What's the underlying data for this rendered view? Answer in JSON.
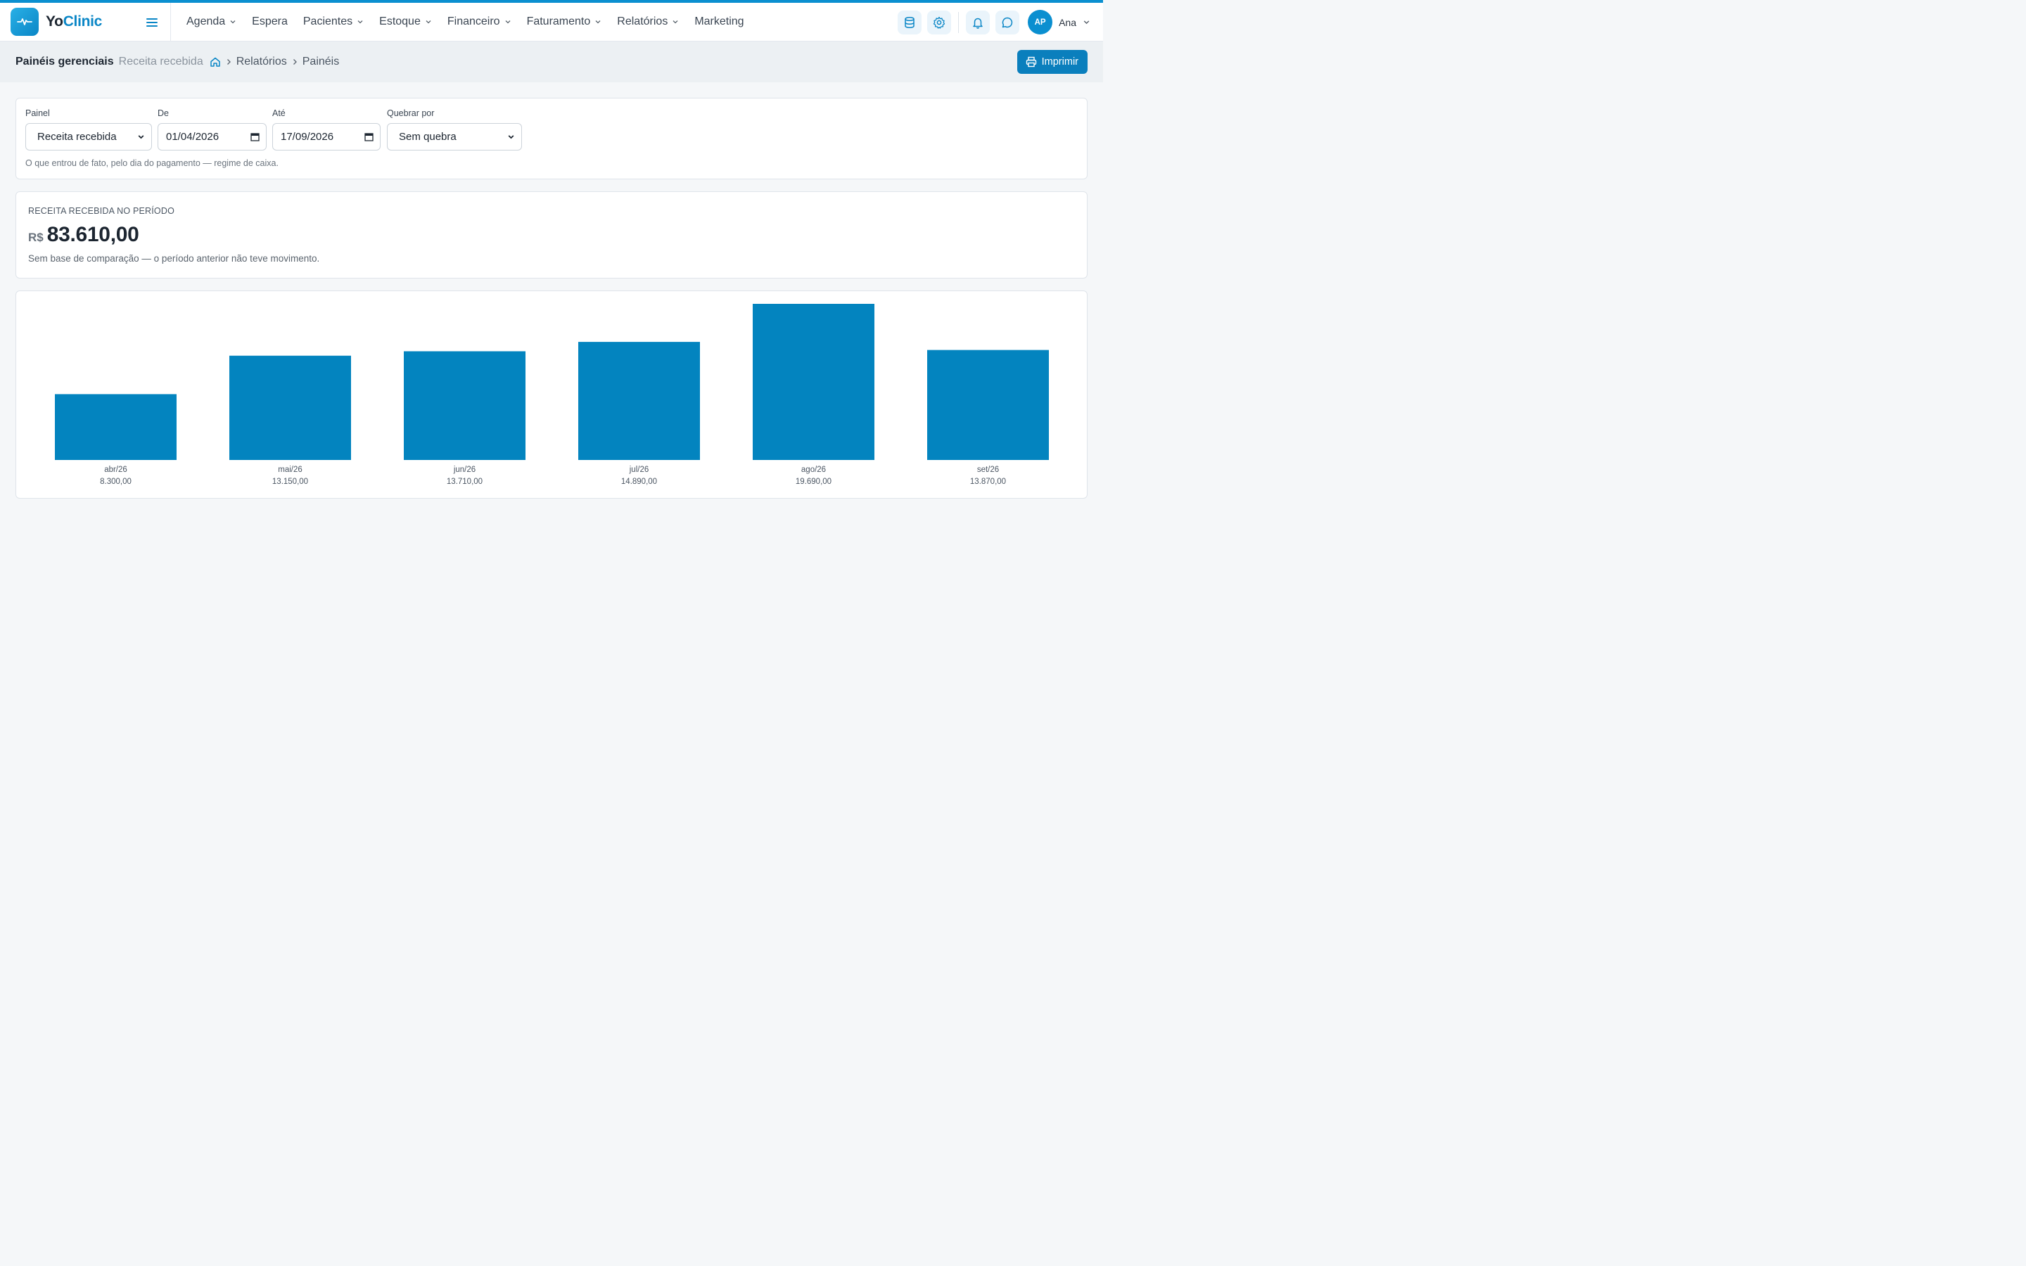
{
  "brand": {
    "name_part1": "Yo",
    "name_part2": "Clinic"
  },
  "menu": [
    {
      "label": "Agenda",
      "dropdown": true
    },
    {
      "label": "Espera",
      "dropdown": false
    },
    {
      "label": "Pacientes",
      "dropdown": true
    },
    {
      "label": "Estoque",
      "dropdown": true
    },
    {
      "label": "Financeiro",
      "dropdown": true
    },
    {
      "label": "Faturamento",
      "dropdown": true
    },
    {
      "label": "Relatórios",
      "dropdown": true
    },
    {
      "label": "Marketing",
      "dropdown": false
    }
  ],
  "user": {
    "initials": "AP",
    "name": "Ana"
  },
  "header": {
    "title": "Painéis gerenciais",
    "subtitle": "Receita recebida",
    "breadcrumb": [
      "Relatórios",
      "Painéis"
    ],
    "print_label": "Imprimir"
  },
  "filters": {
    "panel_label": "Painel",
    "panel_value": "Receita recebida",
    "from_label": "De",
    "from_value": "01/04/2026",
    "to_label": "Até",
    "to_value": "17/09/2026",
    "break_label": "Quebrar por",
    "break_value": "Sem quebra",
    "hint": "O que entrou de fato, pelo dia do pagamento — regime de caixa."
  },
  "kpi": {
    "label": "RECEITA RECEBIDA NO PERÍODO",
    "currency": "R$",
    "amount": "83.610,00",
    "note": "Sem base de comparação — o período anterior não teve movimento."
  },
  "colors": {
    "accent": "#0a8fd0",
    "bar": "#0384bf",
    "button": "#0a7fbd"
  },
  "chart_data": {
    "type": "bar",
    "categories": [
      "abr/26",
      "mai/26",
      "jun/26",
      "jul/26",
      "ago/26",
      "set/26"
    ],
    "values": [
      8300,
      13150,
      13710,
      14890,
      19690,
      13870
    ],
    "value_labels": [
      "8.300,00",
      "13.150,00",
      "13.710,00",
      "14.890,00",
      "19.690,00",
      "13.870,00"
    ],
    "ylim": [
      0,
      19690
    ],
    "grid": false,
    "title": "",
    "xlabel": "",
    "ylabel": ""
  }
}
